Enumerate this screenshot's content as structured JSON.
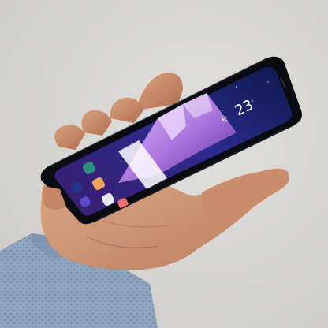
{
  "scene": {
    "description_colors": {
      "background": "#d6d5d1",
      "skin": "#c68e6a",
      "sleeve": "#8aa0bb",
      "phone_frame": "#0c0d12",
      "wallpaper_sky": "#1b1f6b",
      "wallpaper_mountain": "#c79bf0"
    }
  },
  "phone": {
    "clock": "23",
    "clock_icon": "weather-icon"
  },
  "apps": [
    {
      "name": "phone-app-icon",
      "color": "#1f3a8a"
    },
    {
      "name": "messages-app-icon",
      "color": "#2f8f7f"
    },
    {
      "name": "internet-app-icon",
      "color": "#f0a55a"
    },
    {
      "name": "camera-app-icon",
      "color": "#e8e8ef"
    },
    {
      "name": "play-store-app-icon",
      "color": "#f07070"
    },
    {
      "name": "gallery-app-icon",
      "color": "#5a4bd1"
    }
  ]
}
